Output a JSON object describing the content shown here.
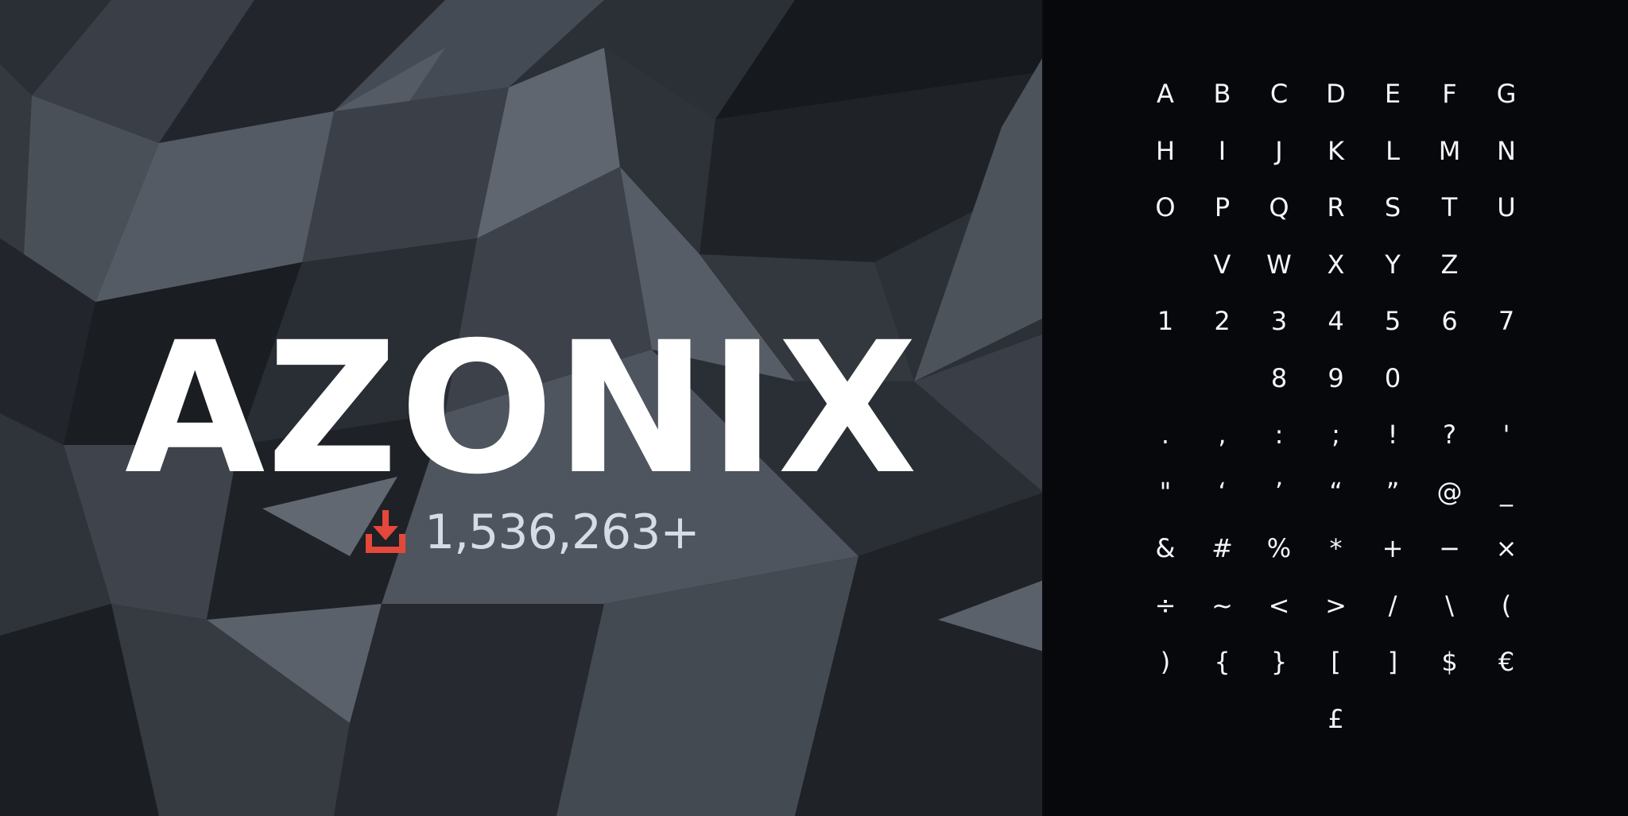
{
  "font_name": "AZONIX",
  "download_count": "1,536,263+",
  "download_icon": "download-icon",
  "accent_color": "#e4483a",
  "background_color": "#08090d",
  "glyph_rows": [
    [
      "A",
      "B",
      "C",
      "D",
      "E",
      "F",
      "G"
    ],
    [
      "H",
      "I",
      "J",
      "K",
      "L",
      "M",
      "N"
    ],
    [
      "O",
      "P",
      "Q",
      "R",
      "S",
      "T",
      "U"
    ],
    [
      "V",
      "W",
      "X",
      "Y",
      "Z"
    ],
    [
      "1",
      "2",
      "3",
      "4",
      "5",
      "6",
      "7"
    ],
    [
      "8",
      "9",
      "0"
    ],
    [
      ".",
      ",",
      ":",
      ";",
      "!",
      "?",
      "'"
    ],
    [
      "\"",
      "‘",
      "’",
      "“",
      "”",
      "@",
      "_"
    ],
    [
      "&",
      "#",
      "%",
      "*",
      "+",
      "−",
      "×"
    ],
    [
      "÷",
      "~",
      "<",
      ">",
      "/",
      "\\",
      "("
    ],
    [
      ")",
      "{",
      "}",
      "[",
      "]",
      "$",
      "€"
    ],
    [
      "£"
    ]
  ]
}
